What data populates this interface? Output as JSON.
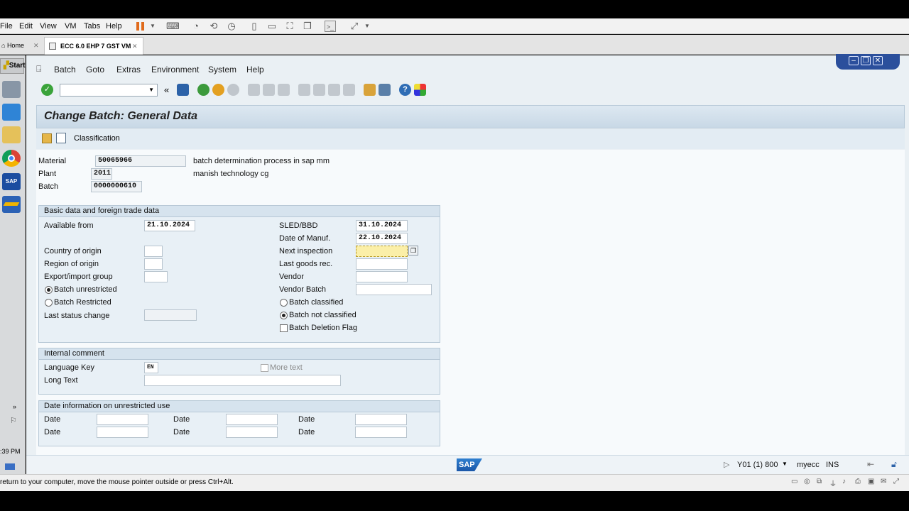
{
  "vm": {
    "menu": [
      "File",
      "Edit",
      "View",
      "VM",
      "Tabs",
      "Help"
    ],
    "tabs": [
      {
        "label": "Home"
      },
      {
        "label": "ECC 6.0 EHP 7 GST VM"
      }
    ],
    "hint": "return to your computer, move the mouse pointer outside or press Ctrl+Alt."
  },
  "taskbar": {
    "start": "Start",
    "time": ":39 PM"
  },
  "sap": {
    "menu": [
      "Batch",
      "Goto",
      "Extras",
      "Environment",
      "System",
      "Help"
    ],
    "title": "Change Batch: General Data",
    "app_toolbar": {
      "classification": "Classification"
    },
    "header": {
      "material_label": "Material",
      "material": "50065966",
      "material_desc": "batch determination process in sap mm",
      "plant_label": "Plant",
      "plant": "2011",
      "plant_desc": "manish technology cg",
      "batch_label": "Batch",
      "batch": "0000000610"
    },
    "basic": {
      "title": "Basic data and foreign trade data",
      "available_from_label": "Available from",
      "available_from": "21.10.2024",
      "country_label": "Country of origin",
      "region_label": "Region of origin",
      "export_label": "Export/import group",
      "unrestricted_label": "Batch unrestricted",
      "restricted_label": "Batch Restricted",
      "last_status_label": "Last status change",
      "sled_label": "SLED/BBD",
      "sled": "31.10.2024",
      "manuf_label": "Date of Manuf.",
      "manuf": "22.10.2024",
      "next_insp_label": "Next inspection",
      "last_gr_label": "Last goods rec.",
      "vendor_label": "Vendor",
      "vendor_batch_label": "Vendor Batch",
      "classified_label": "Batch classified",
      "not_classified_label": "Batch not classified",
      "deletion_label": "Batch Deletion Flag"
    },
    "comment": {
      "title": "Internal comment",
      "lang_label": "Language Key",
      "lang": "EN",
      "more_text": "More text",
      "long_text_label": "Long Text"
    },
    "dates": {
      "title": "Date information on unrestricted use",
      "label": "Date"
    },
    "status": {
      "system": "Y01 (1) 800",
      "host": "myecc",
      "mode": "INS",
      "logo": "SAP"
    }
  }
}
